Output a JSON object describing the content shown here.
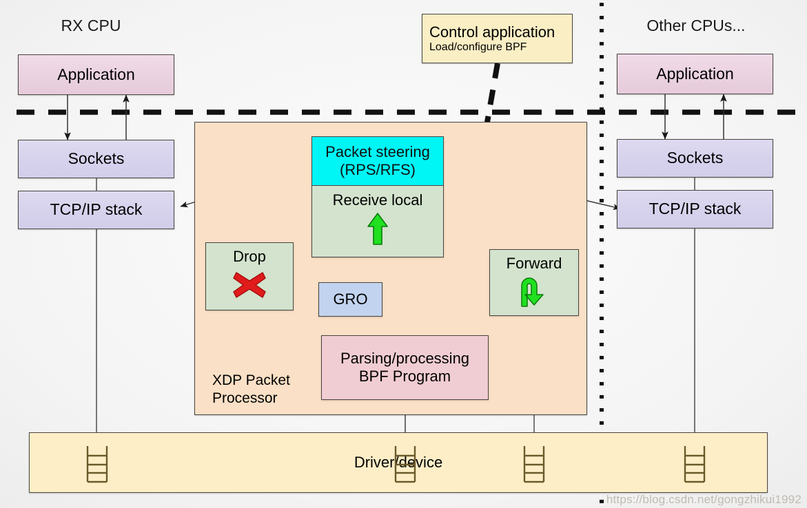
{
  "diagram": {
    "title_left": "RX CPU",
    "title_right": "Other CPUs...",
    "watermark": "https://blog.csdn.net/gongzhikui1992"
  },
  "left_cpu": {
    "application": "Application",
    "sockets": "Sockets",
    "tcpip": "TCP/IP stack"
  },
  "right_cpu": {
    "application": "Application",
    "sockets": "Sockets",
    "tcpip": "TCP/IP stack"
  },
  "control": {
    "line1": "Control application",
    "line2": "Load/configure BPF"
  },
  "xdp": {
    "label": "XDP Packet\nProcessor",
    "packet_steering_line1": "Packet steering",
    "packet_steering_line2": "(RPS/RFS)",
    "receive_local": "Receive local",
    "drop": "Drop",
    "forward": "Forward",
    "gro": "GRO",
    "bpf_line1": "Parsing/processing",
    "bpf_line2": "BPF Program"
  },
  "driver": {
    "label": "Driver/device"
  },
  "icons": {
    "drop": "red-x-icon",
    "forward": "green-uturn-arrow-icon",
    "receive": "green-up-arrow-icon",
    "queue": "queue-ladder-icon"
  },
  "colors": {
    "steering": "#00f5f5",
    "green_box": "#d3e3cd",
    "gro": "#c2d3ef",
    "bpf": "#f0cdd2",
    "xdp_bg": "#fae0c6",
    "driver_bg": "#fdeec7",
    "app": "#ead2e0",
    "sockets": "#d6d1ec",
    "control": "#faeec4",
    "drop_x": "#e01b1b",
    "forward_arrow": "#20e020"
  }
}
